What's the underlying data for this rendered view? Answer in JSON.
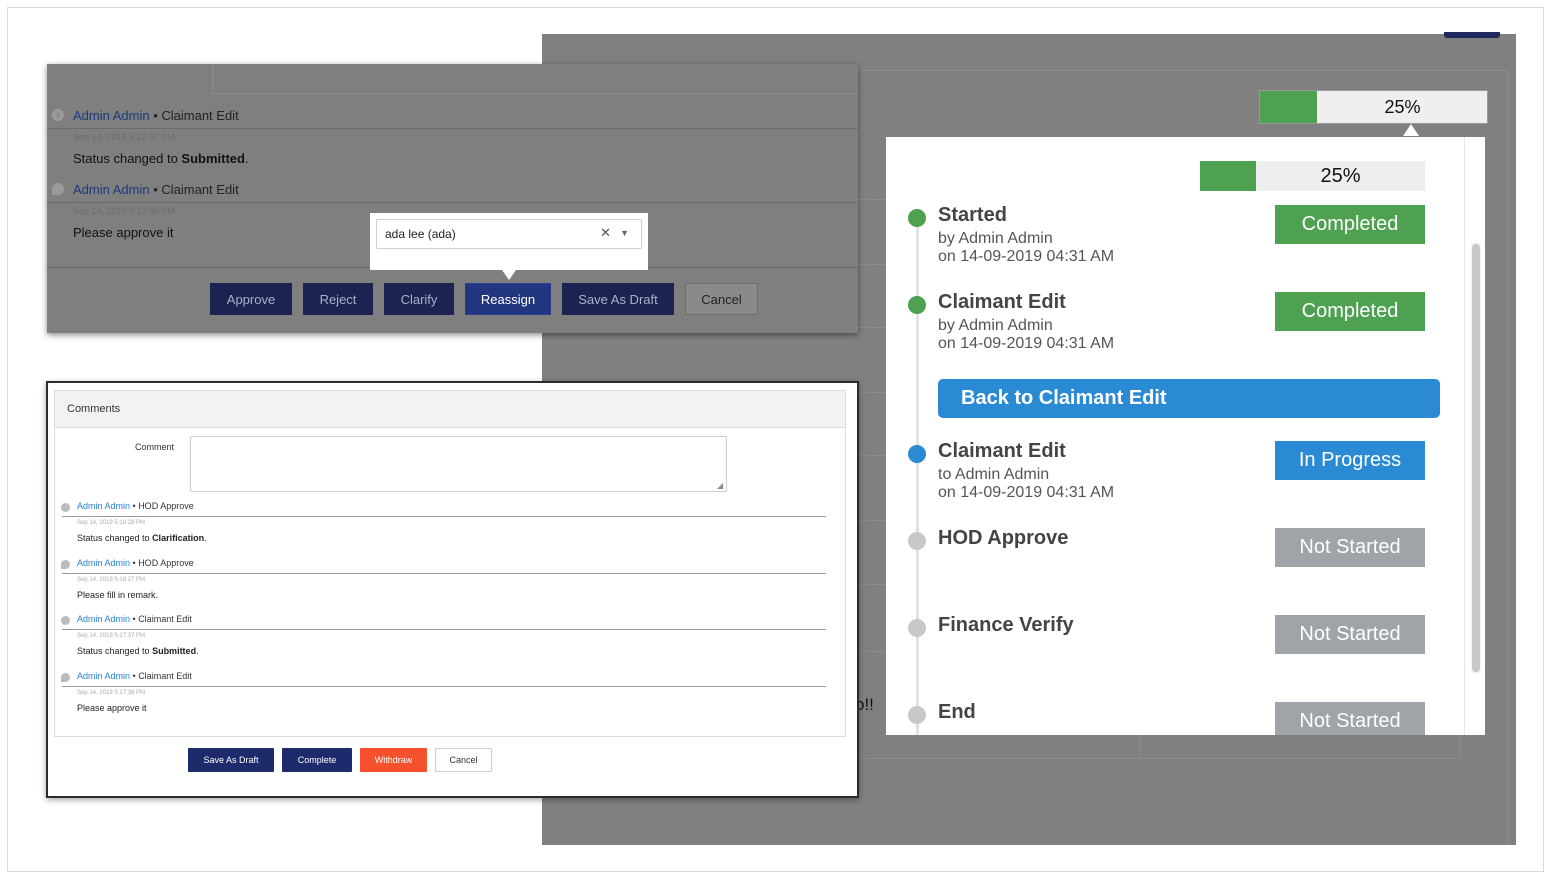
{
  "background": {
    "progress_text": "25%",
    "progress_fraction": 0.25,
    "partial_text": "o!!"
  },
  "approval_dialog": {
    "entries": [
      {
        "icon": "info-icon",
        "author": "Admin Admin",
        "separator": " • ",
        "step": "Claimant Edit",
        "time": "Sep 14, 2019 5:17:37 PM",
        "msg_prefix": "Status changed to ",
        "msg_bold": "Submitted",
        "msg_suffix": "."
      },
      {
        "icon": "comment-icon",
        "author": "Admin Admin",
        "separator": " • ",
        "step": "Claimant Edit",
        "time": "Sep 14, 2019 5:17:36 PM",
        "msg_prefix": "Please approve it",
        "msg_bold": "",
        "msg_suffix": ""
      }
    ],
    "buttons": {
      "approve": "Approve",
      "reject": "Reject",
      "clarify": "Clarify",
      "reassign": "Reassign",
      "save_draft": "Save As Draft",
      "cancel": "Cancel"
    },
    "reassign_select": {
      "value": "ada lee (ada)",
      "clear_symbol": "✕",
      "arrow_symbol": "▼"
    }
  },
  "comments_dialog": {
    "title": "Comments",
    "comment_label": "Comment",
    "comment_value": "",
    "entries": [
      {
        "icon": "info-icon",
        "author": "Admin Admin",
        "separator": " • ",
        "step": "HOD Approve",
        "time": "Sep 14, 2019 5:18:28 PM",
        "msg_prefix": "Status changed to ",
        "msg_bold": "Clarification",
        "msg_suffix": "."
      },
      {
        "icon": "comment-icon",
        "author": "Admin Admin",
        "separator": " • ",
        "step": "HOD Approve",
        "time": "Sep 14, 2019 5:18:27 PM",
        "msg_prefix": "Please fill in remark.",
        "msg_bold": "",
        "msg_suffix": ""
      },
      {
        "icon": "info-icon",
        "author": "Admin Admin",
        "separator": " • ",
        "step": "Claimant Edit",
        "time": "Sep 14, 2019 5:17:37 PM",
        "msg_prefix": "Status changed to ",
        "msg_bold": "Submitted",
        "msg_suffix": "."
      },
      {
        "icon": "comment-icon",
        "author": "Admin Admin",
        "separator": " • ",
        "step": "Claimant Edit",
        "time": "Sep 14, 2019 5:17:36 PM",
        "msg_prefix": "Please approve it",
        "msg_bold": "",
        "msg_suffix": ""
      }
    ],
    "buttons": {
      "save_draft": "Save As Draft",
      "complete": "Complete",
      "withdraw": "Withdraw",
      "cancel": "Cancel"
    }
  },
  "workflow": {
    "progress_text": "25%",
    "progress_fraction": 0.25,
    "back_button": "Back to Claimant Edit",
    "colors": {
      "completed": "#4ea150",
      "in_progress": "#2a8ad4",
      "not_started": "#9ea4a8"
    },
    "steps": [
      {
        "name": "Started",
        "line1": "by Admin Admin",
        "line2": "on 14-09-2019 04:31 AM",
        "status": "Completed",
        "state": "completed"
      },
      {
        "name": "Claimant Edit",
        "line1": "by Admin Admin",
        "line2": "on 14-09-2019 04:31 AM",
        "status": "Completed",
        "state": "completed"
      },
      {
        "name": "Claimant Edit",
        "line1": "to Admin Admin",
        "line2": "on 14-09-2019 04:31 AM",
        "status": "In Progress",
        "state": "in_progress"
      },
      {
        "name": "HOD Approve",
        "line1": "",
        "line2": "",
        "status": "Not Started",
        "state": "not_started"
      },
      {
        "name": "Finance Verify",
        "line1": "",
        "line2": "",
        "status": "Not Started",
        "state": "not_started"
      },
      {
        "name": "End",
        "line1": "",
        "line2": "",
        "status": "Not Started",
        "state": "not_started"
      }
    ]
  }
}
